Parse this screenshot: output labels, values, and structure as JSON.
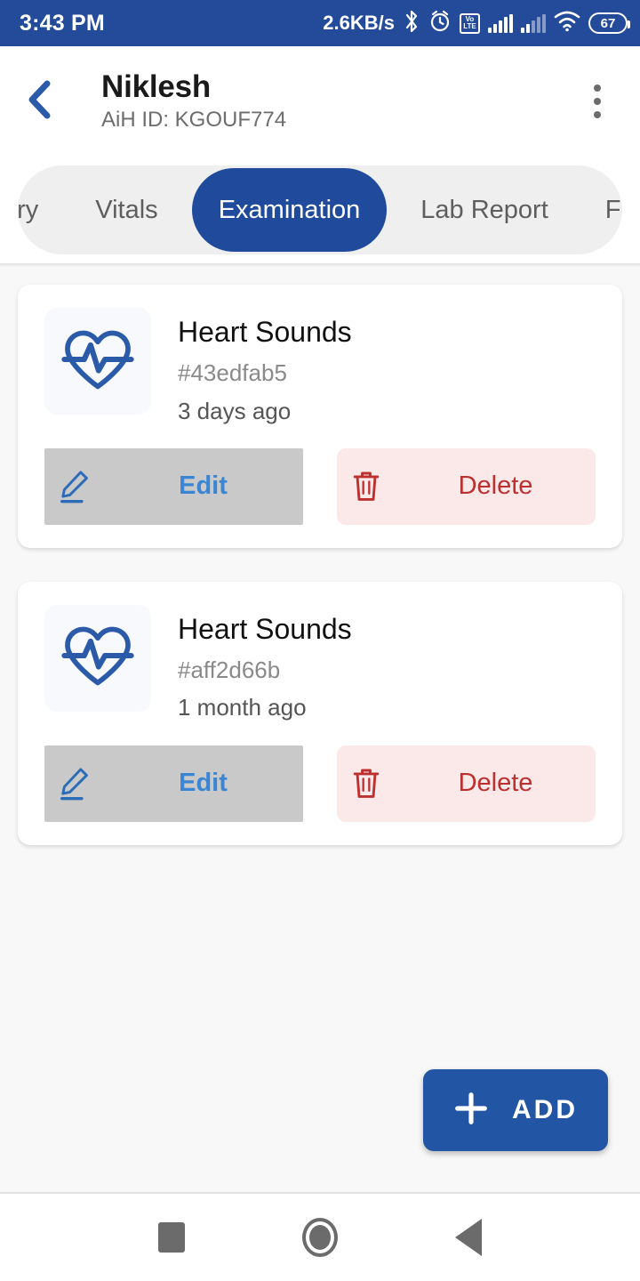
{
  "status_bar": {
    "clock": "3:43 PM",
    "net_speed": "2.6KB/s",
    "volte_top": "Vo",
    "volte_bottom": "LTE",
    "battery_percent": "67",
    "icons": [
      "bluetooth-icon",
      "alarm-icon",
      "volte-icon",
      "signal-icon",
      "signal-secondary-icon",
      "wifi-icon",
      "battery-icon"
    ],
    "bg_color": "#234B9A"
  },
  "app_bar": {
    "back_icon": "chevron-left-icon",
    "patient_name": "Niklesh",
    "patient_id": "AiH ID: KGOUF774",
    "overflow_icon": "more-vertical-icon"
  },
  "tabs": {
    "items": [
      {
        "label": "istory",
        "active": false
      },
      {
        "label": "Vitals",
        "active": false
      },
      {
        "label": "Examination",
        "active": true
      },
      {
        "label": "Lab Report",
        "active": false
      },
      {
        "label": "Fir",
        "active": false
      }
    ],
    "active_color": "#204A9B",
    "track_color": "#efefef"
  },
  "records": [
    {
      "icon": "heart-pulse-icon",
      "title": "Heart Sounds",
      "code": "#43edfab5",
      "time": "3 days ago",
      "edit_label": "Edit",
      "delete_label": "Delete",
      "edit_icon": "pencil-icon",
      "delete_icon": "trash-icon"
    },
    {
      "icon": "heart-pulse-icon",
      "title": "Heart Sounds",
      "code": "#aff2d66b",
      "time": "1 month ago",
      "edit_label": "Edit",
      "delete_label": "Delete",
      "edit_icon": "pencil-icon",
      "delete_icon": "trash-icon"
    }
  ],
  "fab": {
    "label": "ADD",
    "icon": "plus-icon",
    "color": "#2255A4"
  },
  "nav_bar": {
    "recents_icon": "square-icon",
    "home_icon": "circle-icon",
    "back_icon": "triangle-back-icon"
  },
  "colors": {
    "primary_blue": "#204A9B",
    "status_blue": "#234B9A",
    "edit_blue": "#3a86d4",
    "delete_red": "#bc3030",
    "delete_bg": "#fbe8e9",
    "edit_bg": "#c9c9c9",
    "page_bg": "#f8f8f8"
  }
}
